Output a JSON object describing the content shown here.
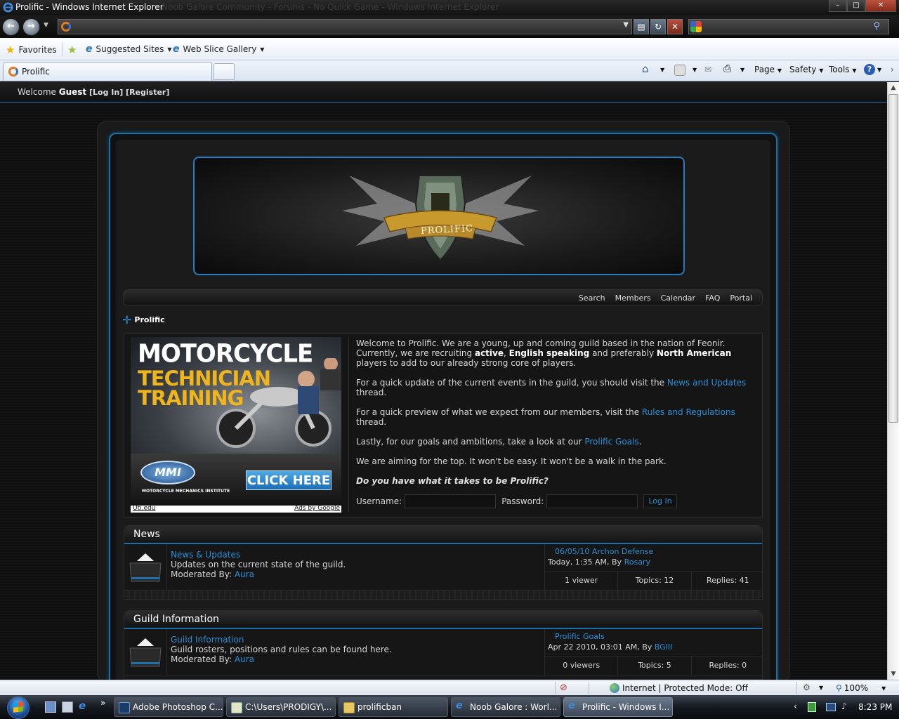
{
  "browser": {
    "title": "Prolific - Windows Internet Explorer",
    "ghost_title": "Noob Galore Community - Forums - No Quick Game - Windows Internet Explorer",
    "window_buttons": [
      "–",
      "□",
      "✕"
    ],
    "favorites": {
      "favorites_label": "Favorites",
      "suggested_sites_label": "Suggested Sites",
      "web_slice_label": "Web Slice Gallery"
    },
    "tab": {
      "label": "Prolific"
    },
    "commands": {
      "page": "Page",
      "safety": "Safety",
      "tools": "Tools",
      "help": "?"
    }
  },
  "forum": {
    "welcome": {
      "prefix": "Welcome",
      "user": "Guest",
      "login": "[Log In]",
      "register": "[Register]"
    },
    "banner": {
      "logo_text": "PROLIFIC"
    },
    "nav_links": [
      "Search",
      "Members",
      "Calendar",
      "FAQ",
      "Portal"
    ],
    "breadcrumb": "Prolific",
    "ad": {
      "line1": "MOTORCYCLE",
      "line2": "TECHNICIAN",
      "line3": "TRAINING",
      "logo": "MMI",
      "logo_caption": "MOTORCYCLE MECHANICS INSTITUTE",
      "cta": "CLICK HERE",
      "source": "Uti.edu",
      "ads_by": "Ads by Google"
    },
    "intro": {
      "p1_a": "Welcome to Prolific. We are a young, up and coming guild based in the nation of Feonir. Currently, we are recruiting ",
      "p1_b1": "active",
      "p1_c": ", ",
      "p1_b2": "English speaking",
      "p1_d": " and preferably ",
      "p1_b3": "North American",
      "p1_e": " players to add to our already strong core of players.",
      "p2_a": "For a quick update of the current events in the guild, you should visit the ",
      "p2_link": "News and Updates",
      "p2_b": " thread.",
      "p3_a": "For a quick preview of what we expect from our members, visit the ",
      "p3_link": "Rules and Regulations",
      "p3_b": " thread.",
      "p4_a": "Lastly, for our goals and ambitions, take a look at our ",
      "p4_link": "Prolific Goals",
      "p4_b": ".",
      "p5": "We are aiming for the top. It won't be easy. It won't be a walk in the park.",
      "p6": "Do you have what it takes to be Prolific?"
    },
    "login": {
      "username_label": "Username:",
      "password_label": "Password:",
      "button": "Log In"
    },
    "categories": [
      {
        "title": "News",
        "forums": [
          {
            "name": "News & Updates",
            "description": "Updates on the current state of the guild.",
            "moderated_label": "Moderated By:",
            "moderator": "Aura",
            "last_post_title": "06/05/10 Archon Defense",
            "last_post_date": "Today, 1:35 AM, By",
            "last_post_user": "Rosary",
            "viewers": "1 viewer",
            "topics": "Topics: 12",
            "replies": "Replies: 41"
          }
        ]
      },
      {
        "title": "Guild Information",
        "forums": [
          {
            "name": "Guild Information",
            "description": "Guild rosters, positions and rules can be found here.",
            "moderated_label": "Moderated By:",
            "moderator": "Aura",
            "last_post_title": "Prolific Goals",
            "last_post_date": "Apr 22 2010, 03:01 AM, By",
            "last_post_user": "BGIII",
            "viewers": "0 viewers",
            "topics": "Topics: 5",
            "replies": "Replies: 0"
          }
        ]
      }
    ]
  },
  "statusbar": {
    "zone": "Internet | Protected Mode: Off",
    "zoom": "100%"
  },
  "taskbar": {
    "tasks": [
      "Adobe Photoshop C...",
      "C:\\Users\\PRODIGY\\...",
      "prolificban",
      "Noob Galore : Worl...",
      "Prolific - Windows I..."
    ],
    "clock": "8:23 PM"
  }
}
